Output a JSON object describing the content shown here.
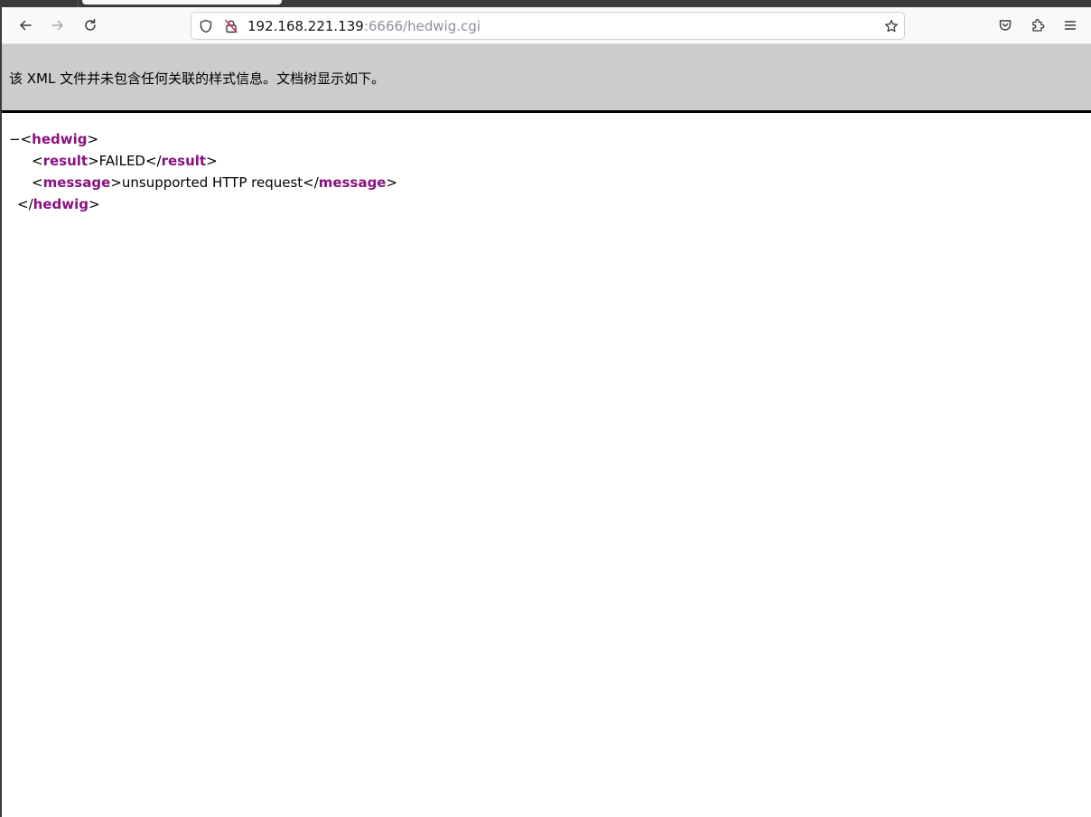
{
  "browser": {
    "url_host": "192.168.221.139",
    "url_rest": ":6666/hedwig.cgi"
  },
  "icons": {
    "back": "arrow-left-icon",
    "forward": "arrow-right-icon",
    "reload": "reload-icon",
    "shield": "shield-icon",
    "insecure_lock": "insecure-lock-icon",
    "bookmark": "star-icon",
    "pocket": "pocket-icon",
    "extensions": "puzzle-icon",
    "menu": "hamburger-menu-icon"
  },
  "banner": {
    "text": "该 XML 文件并未包含任何关联的样式信息。文档树显示如下。"
  },
  "xml_tree": {
    "collapse_marker": "−",
    "root_tag": "hedwig",
    "children": [
      {
        "tag": "result",
        "text": "FAILED"
      },
      {
        "tag": "message",
        "text": "unsupported HTTP request"
      }
    ]
  },
  "colors": {
    "tag": "#881280",
    "banner_bg": "#cccccc",
    "toolbar_bg": "#f9f9fb"
  }
}
